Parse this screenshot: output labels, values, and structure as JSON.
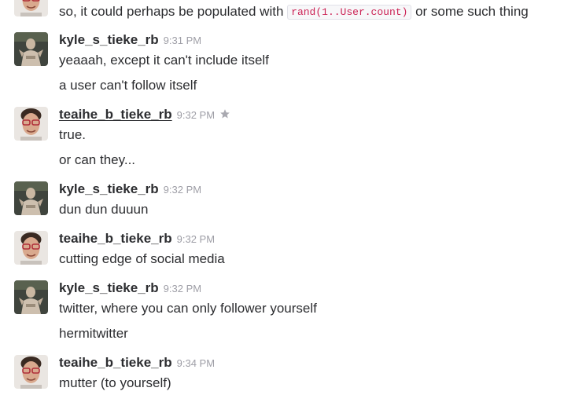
{
  "messages": [
    {
      "text_before_code": "so, it could perhaps be populated with ",
      "code": "rand(1..User.count)",
      "text_after_code": " or some such thing"
    },
    {
      "user": "kyle_s_tieke_rb",
      "time": "9:31 PM",
      "lines": [
        "yeaaah, except it can't include itself",
        "a user can't follow itself"
      ]
    },
    {
      "user": "teaihe_b_tieke_rb",
      "time": "9:32 PM",
      "lines": [
        "true.",
        "or can they..."
      ]
    },
    {
      "user": "kyle_s_tieke_rb",
      "time": "9:32 PM",
      "lines": [
        "dun dun duuun"
      ]
    },
    {
      "user": "teaihe_b_tieke_rb",
      "time": "9:32 PM",
      "lines": [
        "cutting edge of social media"
      ]
    },
    {
      "user": "kyle_s_tieke_rb",
      "time": "9:32 PM",
      "lines": [
        "twitter, where you can only follower yourself",
        "hermitwitter"
      ]
    },
    {
      "user": "teaihe_b_tieke_rb",
      "time": "9:34 PM",
      "lines": [
        "mutter (to yourself)"
      ]
    }
  ],
  "icons": {
    "star": "star-icon",
    "kyle_avatar": "avatar-kyle",
    "teaihe_avatar": "avatar-teaihe"
  },
  "colors": {
    "timestamp": "#9e9ea6",
    "code": "#cc2255",
    "text": "#2c2d30"
  }
}
